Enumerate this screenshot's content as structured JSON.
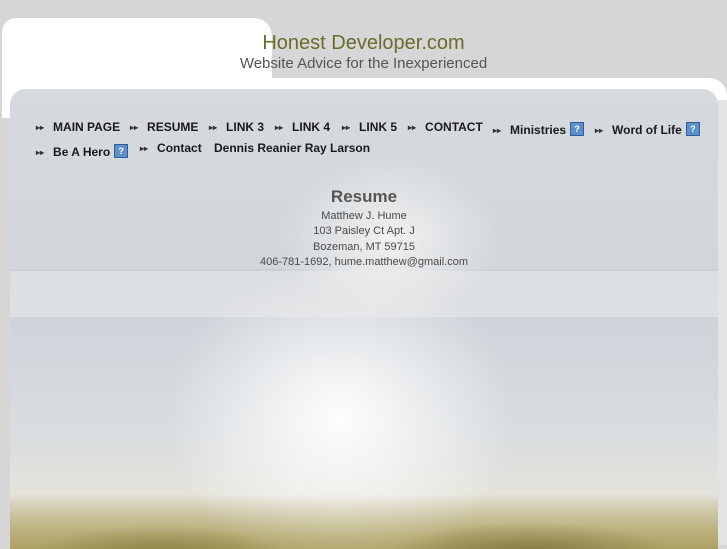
{
  "header": {
    "title": "Honest Developer.com",
    "subtitle": "Website Advice for the Inexperienced"
  },
  "nav": {
    "items": [
      {
        "label": "MAIN PAGE",
        "help": false
      },
      {
        "label": "RESUME",
        "help": false
      },
      {
        "label": "LINK 3",
        "help": false
      },
      {
        "label": "LINK 4",
        "help": false
      },
      {
        "label": "LINK 5",
        "help": false
      },
      {
        "label": "CONTACT",
        "help": false
      },
      {
        "label": "Ministries",
        "help": true
      },
      {
        "label": "Word of Life",
        "help": true
      },
      {
        "label": "Be A Hero",
        "help": true
      },
      {
        "label": "Contact",
        "help": false
      },
      {
        "label": "Dennis Reanier Ray Larson",
        "help": false
      }
    ],
    "help_glyph": "?",
    "arrow_glyph": "▸▸"
  },
  "resume": {
    "heading": "Resume",
    "name": "Matthew J. Hume",
    "address1": "103 Paisley Ct Apt. J",
    "address2": "Bozeman, MT 59715",
    "contact": "406-781-1692, hume.matthew@gmail.com"
  },
  "colors": {
    "title": "#6b6b2e",
    "help_icon": "#5d8fc9"
  }
}
